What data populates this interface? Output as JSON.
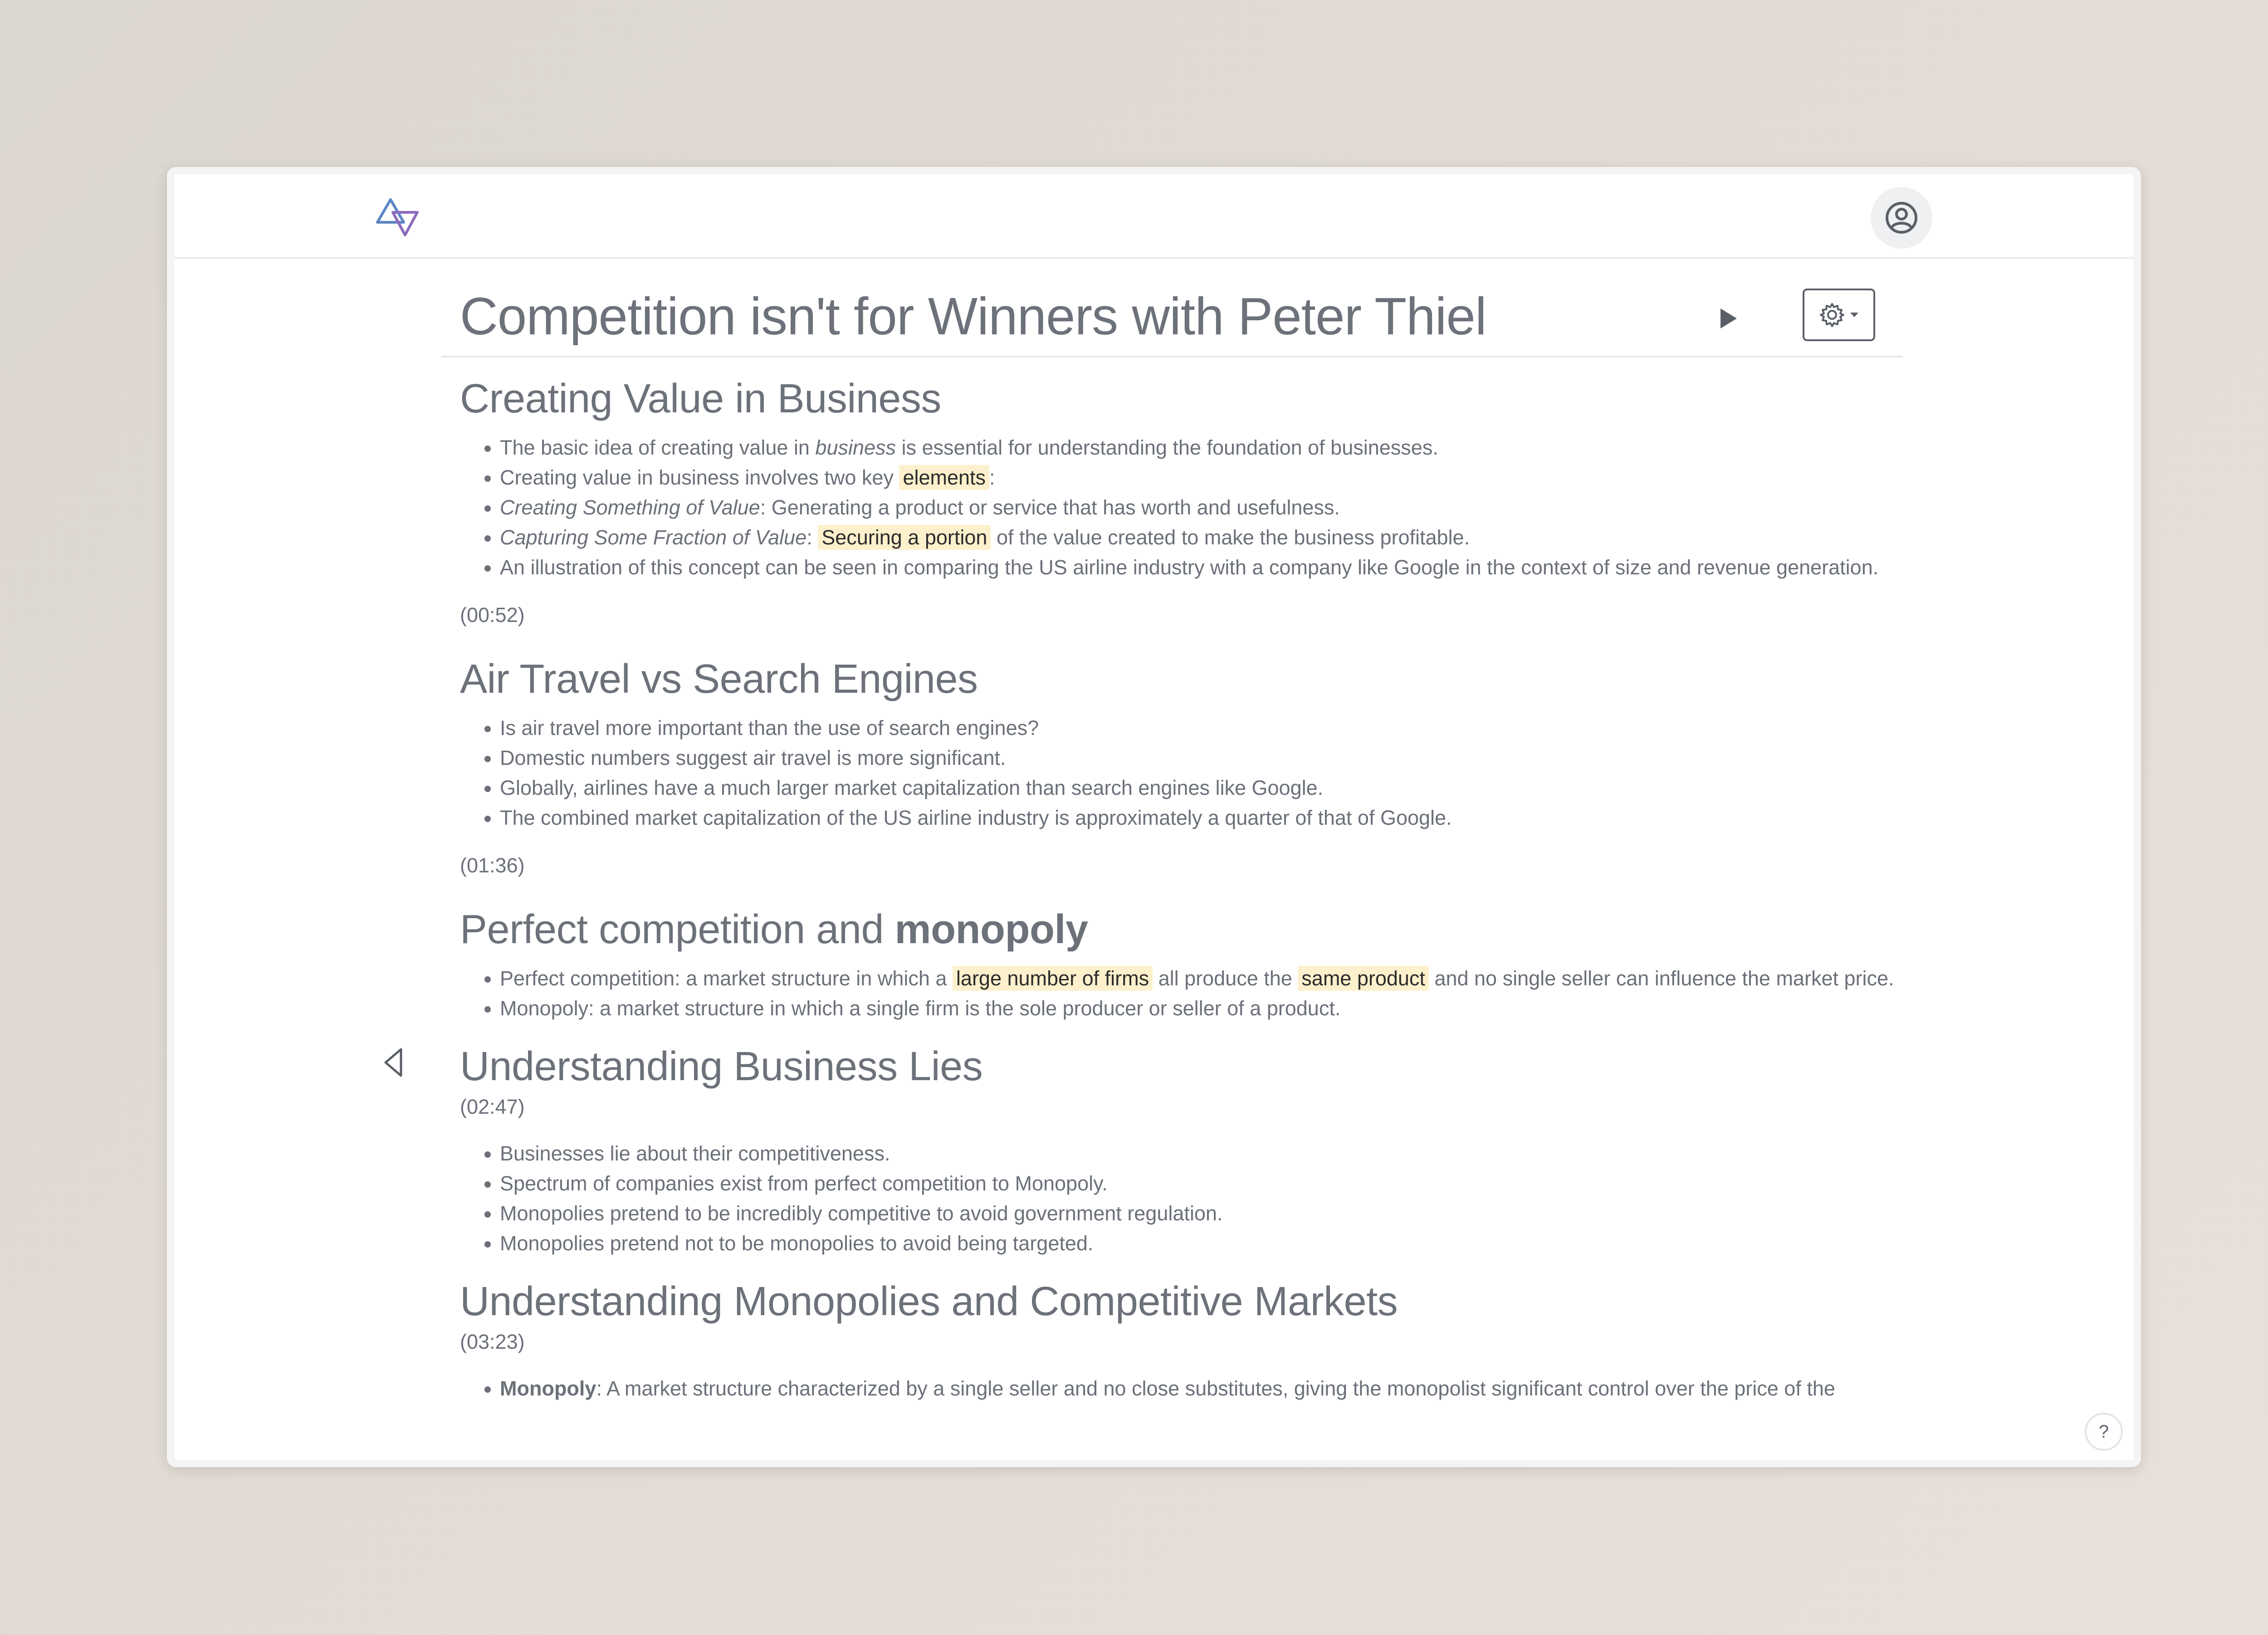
{
  "header": {
    "logo_icon": "triangles-logo-icon",
    "account_icon": "user-circle-icon"
  },
  "document": {
    "title": "Competition isn't for Winners with Peter Thiel",
    "play_icon": "play-icon",
    "settings_icon": "gear-icon"
  },
  "sections": [
    {
      "heading": "Creating Value in Business",
      "b0_pre": "The basic idea of creating value in ",
      "b0_em": "business",
      "b0_post": " is essential for understanding the foundation of businesses.",
      "b1_pre": "Creating value in business involves two key ",
      "b1_hl": "elements",
      "b1_post": ":",
      "b2_em": "Creating Something of Value",
      "b2_post": ": Generating a product or service that has worth and usefulness.",
      "b3_em": "Capturing Some Fraction of Value",
      "b3_mid": ": ",
      "b3_hl": "Securing a portion",
      "b3_post": " of the value created to make the business profitable.",
      "b4": "An illustration of this concept can be seen in comparing the US airline industry with a company like Google in the context of size and revenue generation.",
      "timestamp": "(00:52)"
    },
    {
      "heading": "Air Travel vs Search Engines",
      "bullets": [
        "Is air travel more important than the use of search engines?",
        "Domestic numbers suggest air travel is more significant.",
        "Globally, airlines have a much larger market capitalization than search engines like Google.",
        "The combined market capitalization of the US airline industry is approximately a quarter of that of Google."
      ],
      "timestamp": "(01:36)"
    },
    {
      "heading_pre": "Perfect competition and ",
      "heading_bold": "monopoly",
      "b0_pre": "Perfect competition: a market structure in which a ",
      "b0_hl1": "large number of firms",
      "b0_mid": " all produce the ",
      "b0_hl2": "same product",
      "b0_post": " and no single seller can influence the market price.",
      "b1": "Monopoly: a market structure in which a single firm is the sole producer or seller of a product."
    },
    {
      "heading": "Understanding Business Lies",
      "timestamp": "(02:47)",
      "bullets": [
        "Businesses lie about their competitiveness.",
        "Spectrum of companies exist from perfect competition to Monopoly.",
        "Monopolies pretend to be incredibly competitive to avoid government regulation.",
        "Monopolies pretend not to be monopolies to avoid being targeted."
      ]
    },
    {
      "heading": "Understanding Monopolies and Competitive Markets",
      "timestamp": "(03:23)",
      "b0_bold": "Monopoly",
      "b0_post": ": A market structure characterized by a single seller and no close substitutes, giving the monopolist significant control over the price of the"
    }
  ],
  "nav": {
    "back_icon": "chevron-left-icon"
  },
  "help": {
    "label": "?"
  }
}
